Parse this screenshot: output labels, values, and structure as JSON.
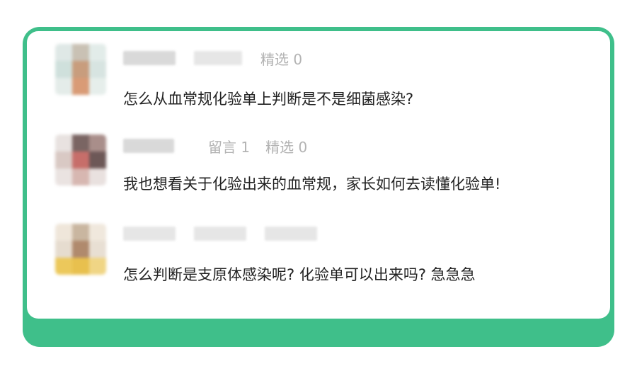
{
  "colors": {
    "frame": "#3fbf8a",
    "card": "#ffffff",
    "meta_text": "#b3b3b3",
    "body_text": "#222222"
  },
  "comments": [
    {
      "featured_label": "精选 0",
      "text": "怎么从血常规化验单上判断是不是细菌感染?"
    },
    {
      "reply_label": "留言 1",
      "featured_label": "精选 0",
      "text": "我也想看关于化验出来的血常规，家长如何去读懂化验单!"
    },
    {
      "text": "怎么判断是支原体感染呢? 化验单可以出来吗? 急急急"
    }
  ]
}
